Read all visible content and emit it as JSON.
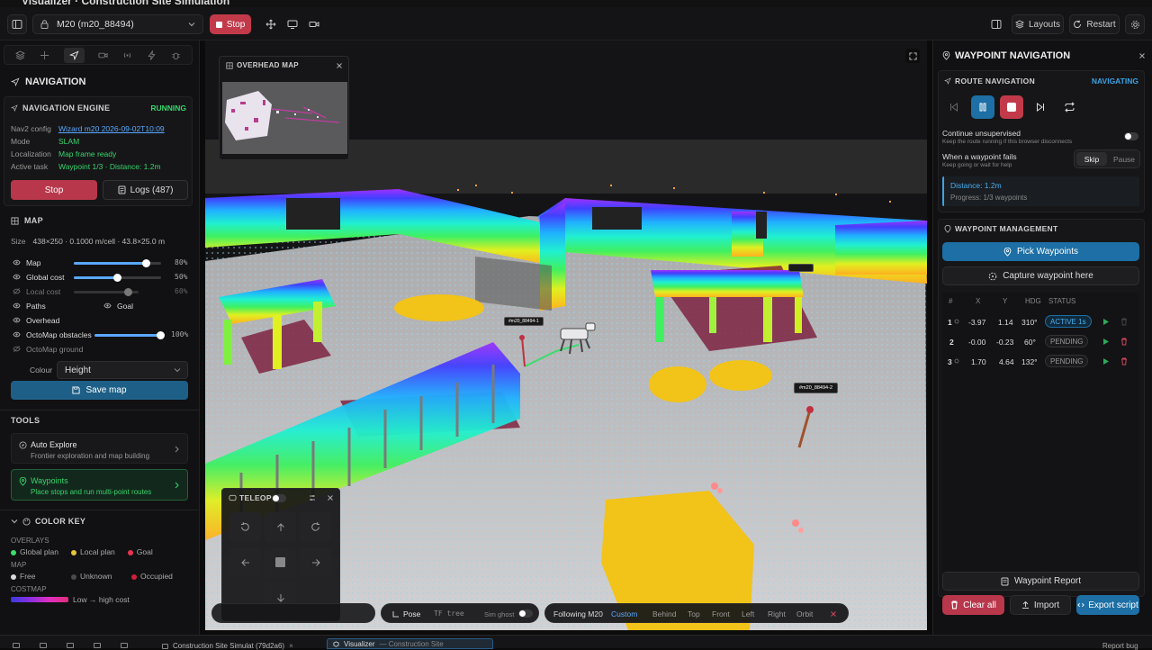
{
  "window": {
    "title": "Visualizer · Construction Site Simulation"
  },
  "toolbar": {
    "robot_select": "M20 (m20_88494)",
    "stop_label": "Stop",
    "layouts_label": "Layouts",
    "restart_label": "Restart"
  },
  "left": {
    "navigation": {
      "title": "NAVIGATION",
      "engine_title": "NAVIGATION ENGINE",
      "engine_status": "RUNNING",
      "rows": [
        {
          "label": "Nav2 config",
          "value": "Wizard m20 2026-09-02T10:09"
        },
        {
          "label": "Mode",
          "value": "SLAM"
        },
        {
          "label": "Localization",
          "value": "Map frame ready"
        },
        {
          "label": "Active task",
          "value": "Waypoint 1/3 · Distance: 1.2m"
        }
      ],
      "stop_label": "Stop",
      "logs_label": "Logs (487)"
    },
    "map": {
      "title": "MAP",
      "size_label": "Size",
      "size_value": "438×250 · 0.1000 m/cell · 43.8×25.0 m",
      "layers": [
        {
          "label": "Map",
          "percent": "80%",
          "level": 0.8
        },
        {
          "label": "Global cost",
          "percent": "50%",
          "level": 0.5
        },
        {
          "label": "Local cost",
          "percent": "60%",
          "level": 0.6
        },
        {
          "label": "Paths"
        },
        {
          "label": "Overhead"
        },
        {
          "label": "OctoMap obstacles",
          "percent": "100%",
          "level": 1.0
        },
        {
          "label": "OctoMap ground"
        }
      ],
      "goal_label": "Goal",
      "colour_label": "Colour",
      "colour_value": "Height",
      "save_label": "Save map"
    },
    "tools": {
      "title": "TOOLS",
      "items": [
        {
          "title": "Auto Explore",
          "desc": "Frontier exploration and map building"
        },
        {
          "title": "Waypoints",
          "desc": "Place stops and run multi-point routes"
        }
      ]
    },
    "color_key": {
      "title": "COLOR KEY",
      "overlays_label": "OVERLAYS",
      "overlays": [
        {
          "label": "Global plan",
          "color": "#3ddc6b"
        },
        {
          "label": "Local plan",
          "color": "#e8c23a"
        },
        {
          "label": "Goal",
          "color": "#e8344f"
        }
      ],
      "map_label": "MAP",
      "map_items": [
        {
          "label": "Free",
          "color": "#d9d9d9"
        },
        {
          "label": "Unknown",
          "color": "#4a4a4a"
        },
        {
          "label": "Occupied",
          "color": "#d21e3c"
        }
      ],
      "costmap_label": "COSTMAP",
      "costmap_text": "Low → high cost"
    }
  },
  "viewport": {
    "overhead_title": "OVERHEAD MAP",
    "teleop_title": "TELEOP",
    "marker1": "#m20_88494-1",
    "marker2": "#m20_88494-2",
    "bottom_bar": {
      "pose_label": "Pose",
      "tf_label": "TF tree",
      "sim_ghost_label": "Sim ghost",
      "following_label": "Following M20",
      "views": [
        "Custom",
        "Behind",
        "Top",
        "Front",
        "Left",
        "Right",
        "Orbit"
      ]
    }
  },
  "right": {
    "title": "WAYPOINT NAVIGATION",
    "route": {
      "title": "ROUTE NAVIGATION",
      "status": "NAVIGATING",
      "continue_label": "Continue unsupervised",
      "continue_desc": "Keep the route running if this browser disconnects",
      "fail_label": "When a waypoint fails",
      "fail_desc": "Keep going or wait for help",
      "skip_label": "Skip",
      "pause_label": "Pause",
      "distance": "Distance: 1.2m",
      "progress": "Progress: 1/3 waypoints"
    },
    "management": {
      "title": "WAYPOINT MANAGEMENT",
      "pick_label": "Pick Waypoints",
      "capture_label": "Capture waypoint here",
      "columns": [
        "#",
        "X",
        "Y",
        "HDG",
        "STATUS"
      ],
      "rows": [
        {
          "n": "1",
          "x": "-3.97",
          "y": "1.14",
          "hdg": "310°",
          "status": "ACTIVE 1s"
        },
        {
          "n": "2",
          "x": "-0.00",
          "y": "-0.23",
          "hdg": "60°",
          "status": "PENDING"
        },
        {
          "n": "3",
          "x": "1.70",
          "y": "4.64",
          "hdg": "132°",
          "status": "PENDING"
        }
      ],
      "report_label": "Waypoint Report",
      "clear_label": "Clear all",
      "import_label": "Import",
      "export_label": "Export script"
    }
  },
  "taskbar": {
    "tab1": "Construction Site Simulat (79d2a6)",
    "tab2": "Visualizer",
    "tab2_sub": "— Construction Site",
    "report_bug": "Report bug"
  }
}
